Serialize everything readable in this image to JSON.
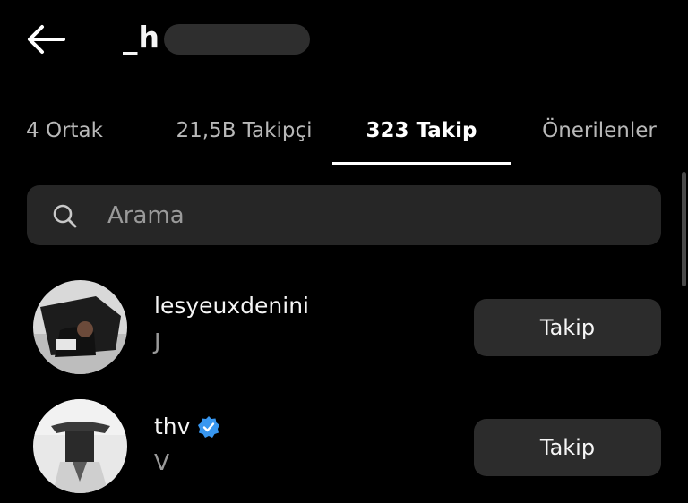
{
  "header": {
    "title": "_h",
    "back_icon": "arrow-left-icon"
  },
  "tabs": [
    {
      "label": "4 Ortak",
      "active": false
    },
    {
      "label": "21,5B Takipçi",
      "active": false
    },
    {
      "label": "323 Takip",
      "active": true
    },
    {
      "label": "Önerilenler",
      "active": false
    }
  ],
  "search": {
    "placeholder": "Arama",
    "value": ""
  },
  "users": [
    {
      "username": "lesyeuxdenini",
      "full_name": "J",
      "verified": false,
      "button_label": "Takip"
    },
    {
      "username": "thv",
      "full_name": "V",
      "verified": true,
      "button_label": "Takip"
    }
  ],
  "colors": {
    "background": "#000000",
    "button": "#2c2c2c",
    "verified": "#3897f0",
    "search_bg": "#262626"
  }
}
